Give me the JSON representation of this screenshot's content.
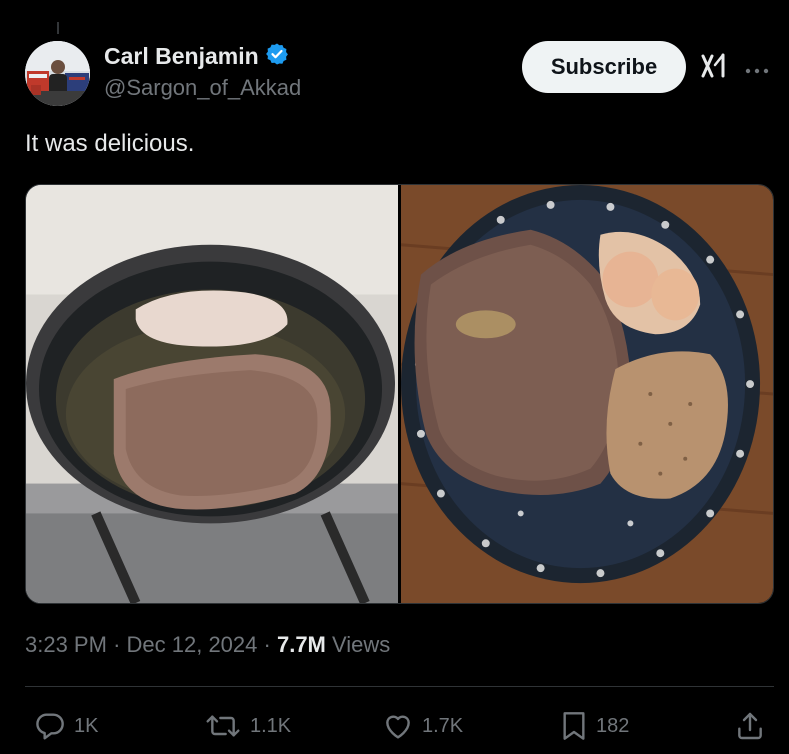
{
  "author": {
    "display_name": "Carl Benjamin",
    "handle": "@Sargon_of_Akkad",
    "verified": true
  },
  "header": {
    "subscribe_label": "Subscribe"
  },
  "tweet": {
    "text": "It was delicious."
  },
  "media": [
    {
      "description_icon": "photo"
    },
    {
      "description_icon": "photo"
    }
  ],
  "meta": {
    "time": "3:23 PM",
    "separator": "·",
    "date": "Dec 12, 2024",
    "views_count": "7.7M",
    "views_label": "Views"
  },
  "actions": {
    "replies": "1K",
    "reposts": "1.1K",
    "likes": "1.7K",
    "bookmarks": "182"
  },
  "colors": {
    "background": "#000000",
    "text_primary": "#e7e9ea",
    "text_secondary": "#71767b",
    "verified_badge": "#1d9bf0",
    "button_bg": "#eff3f4"
  }
}
